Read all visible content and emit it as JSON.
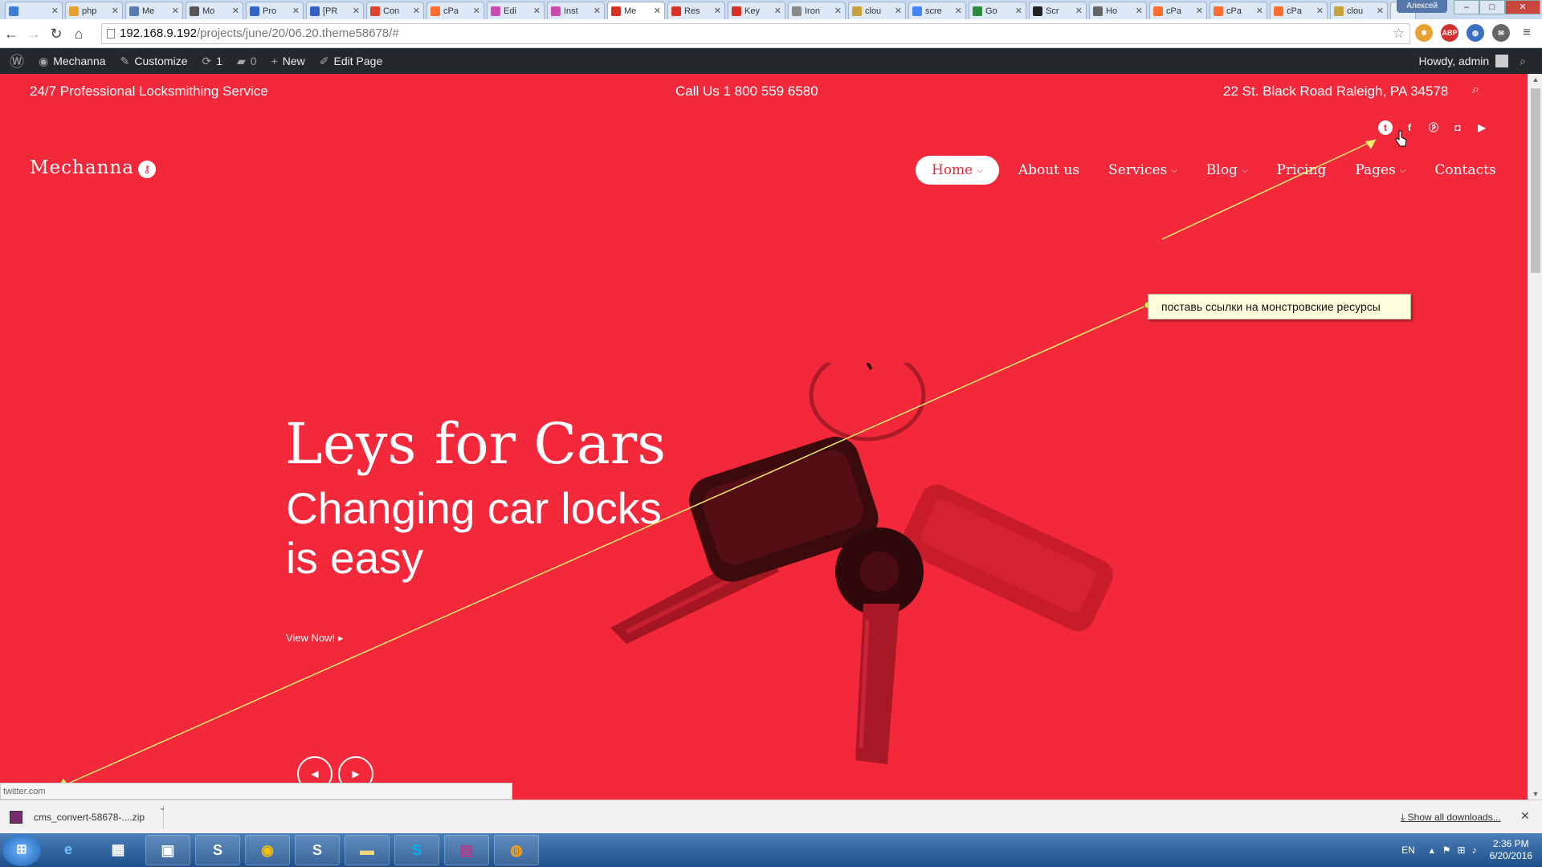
{
  "browser": {
    "tabs": [
      {
        "label": "",
        "color": "#3b7dd8"
      },
      {
        "label": "php",
        "color": "#e8a030"
      },
      {
        "label": "Me",
        "color": "#5a79b5"
      },
      {
        "label": "Mo",
        "color": "#555555"
      },
      {
        "label": "Pro",
        "color": "#3463c7"
      },
      {
        "label": "[PR",
        "color": "#3463c7"
      },
      {
        "label": "Con",
        "color": "#e2432a"
      },
      {
        "label": "cPa",
        "color": "#ff6c2c"
      },
      {
        "label": "Edi",
        "color": "#c94bb0"
      },
      {
        "label": "Inst",
        "color": "#c94bb0"
      },
      {
        "label": "Me",
        "color": "#d93025",
        "active": true
      },
      {
        "label": "Res",
        "color": "#d93025"
      },
      {
        "label": "Key",
        "color": "#d93025"
      },
      {
        "label": "Iron",
        "color": "#888888"
      },
      {
        "label": "clou",
        "color": "#c9a13b"
      },
      {
        "label": "scre",
        "color": "#4285f4"
      },
      {
        "label": "Go",
        "color": "#2a8b3b"
      },
      {
        "label": "Scr",
        "color": "#222222"
      },
      {
        "label": "Ho",
        "color": "#666666"
      },
      {
        "label": "cPa",
        "color": "#ff6c2c"
      },
      {
        "label": "cPa",
        "color": "#ff6c2c"
      },
      {
        "label": "cPa",
        "color": "#ff6c2c"
      },
      {
        "label": "clou",
        "color": "#c9a13b"
      }
    ],
    "window_user": "Алексей",
    "url_host": "192.168.9.192",
    "url_path": "/projects/june/20/06.20.theme58678/#"
  },
  "adminbar": {
    "site_name": "Mechanna",
    "customize": "Customize",
    "updates": "1",
    "comments": "0",
    "new": "New",
    "edit_page": "Edit Page",
    "howdy": "Howdy, admin"
  },
  "site": {
    "accent": "#f3283a",
    "topline": {
      "tagline": "24/7 Professional Locksmithing Service",
      "phone": "Call Us 1 800 559 6580",
      "address": "22 St. Black Road Raleigh, PA 34578"
    },
    "social": [
      "twitter-icon",
      "facebook-icon",
      "pinterest-icon",
      "instagram-icon",
      "youtube-icon"
    ],
    "logo": "Mechanna",
    "menu": [
      {
        "label": "Home",
        "active": true,
        "dropdown": true
      },
      {
        "label": "About us"
      },
      {
        "label": "Services",
        "dropdown": true
      },
      {
        "label": "Blog",
        "dropdown": true
      },
      {
        "label": "Pricing"
      },
      {
        "label": "Pages",
        "dropdown": true
      },
      {
        "label": "Contacts"
      }
    ],
    "hero": {
      "title": "Leys for Cars",
      "subtitle": "Changing car locks is easy",
      "button": "View Now!"
    }
  },
  "annotation": {
    "note": "поставь ссылки на монстровские ресурсы"
  },
  "status_url": "twitter.com",
  "downloads": {
    "file": "cms_convert-58678-....zip",
    "show_all": "Show all downloads..."
  },
  "taskbar": {
    "lang": "EN",
    "time": "2:36 PM",
    "date": "6/20/2016"
  }
}
